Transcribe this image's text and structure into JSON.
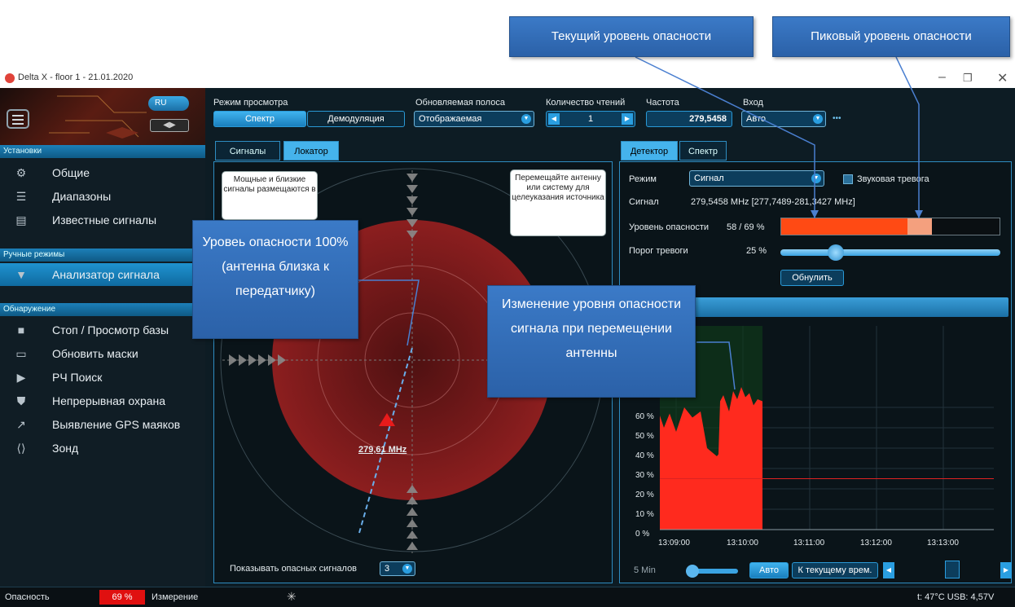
{
  "window": {
    "title": "Delta X - floor 1 - 21.01.2020"
  },
  "callouts": {
    "current": "Текущий уровень опасности",
    "peak": "Пиковый уровень опасности",
    "full": "Уровеь опасности 100% (антенна близка к передатчику)",
    "change": "Изменение уровня опасности сигнала при перемещении антенны"
  },
  "sidebar": {
    "lang": "RU",
    "sections": {
      "settings": "Установки",
      "manual": "Ручные режимы",
      "detect": "Обнаружение"
    },
    "settings_items": [
      "Общие",
      "Диапазоны",
      "Известные сигналы"
    ],
    "manual_items": [
      "Анализатор сигнала"
    ],
    "detect_items": [
      "Стоп / Просмотр базы",
      "Обновить маски",
      "РЧ Поиск",
      "Непрерывная охрана",
      "Выявление GPS маяков",
      "Зонд"
    ]
  },
  "toolbar": {
    "view_mode_label": "Режим просмотра",
    "view_spectrum": "Спектр",
    "view_demod": "Демодуляция",
    "band_label": "Обновляемая полоса",
    "band_value": "Отображаемая",
    "reads_label": "Количество чтений",
    "reads_value": "1",
    "freq_label": "Частота",
    "freq_value": "279,5458",
    "input_label": "Вход",
    "input_value": "Авто",
    "more": "•••"
  },
  "locator": {
    "tab_signals": "Сигналы",
    "tab_locator": "Локатор",
    "hint_left": "Мощные и близкие сигналы размещаются в",
    "hint_right": "Перемещайте антенну или систему для целеуказания источника",
    "target_label": "279,61 MHz",
    "show_label": "Показывать опасных сигналов",
    "show_value": "3"
  },
  "detector": {
    "tab_detector": "Детектор",
    "tab_spectrum": "Спектр",
    "mode_label": "Режим",
    "mode_value": "Сигнал",
    "sound_alarm": "Звуковая тревога",
    "signal_label": "Сигнал",
    "signal_value": "279,5458 MHz [277,7489-281,3427 MHz]",
    "danger_label": "Уровень опасности",
    "danger_value": "58 / 69 %",
    "danger_current": 0.58,
    "danger_peak": 0.69,
    "threshold_label": "Порог тревоги",
    "threshold_value": "25 %",
    "threshold_level": 0.25,
    "reset": "Обнулить"
  },
  "chart_data": {
    "type": "area",
    "yticks": [
      "0 %",
      "10 %",
      "20 %",
      "30 %",
      "40 %",
      "50 %",
      "60 %"
    ],
    "xticks": [
      "13:09:00",
      "13:10:00",
      "13:11:00",
      "13:12:00",
      "13:13:00"
    ],
    "threshold": 25,
    "ylim": [
      0,
      100
    ],
    "color": "#ff2a1e"
  },
  "chart_controls": {
    "range": "5 Min",
    "auto": "Авто",
    "to_now": "К текущему врем."
  },
  "status": {
    "danger_label": "Опасность",
    "danger_value": "69 %",
    "measure": "Измерение",
    "right": "t: 47°C  USB: 4,57V"
  },
  "colors": {
    "accent": "#2a9ee0",
    "danger": "#ff4a14",
    "peak": "#f4a07e",
    "sidebar_active": "#1f93d0"
  }
}
